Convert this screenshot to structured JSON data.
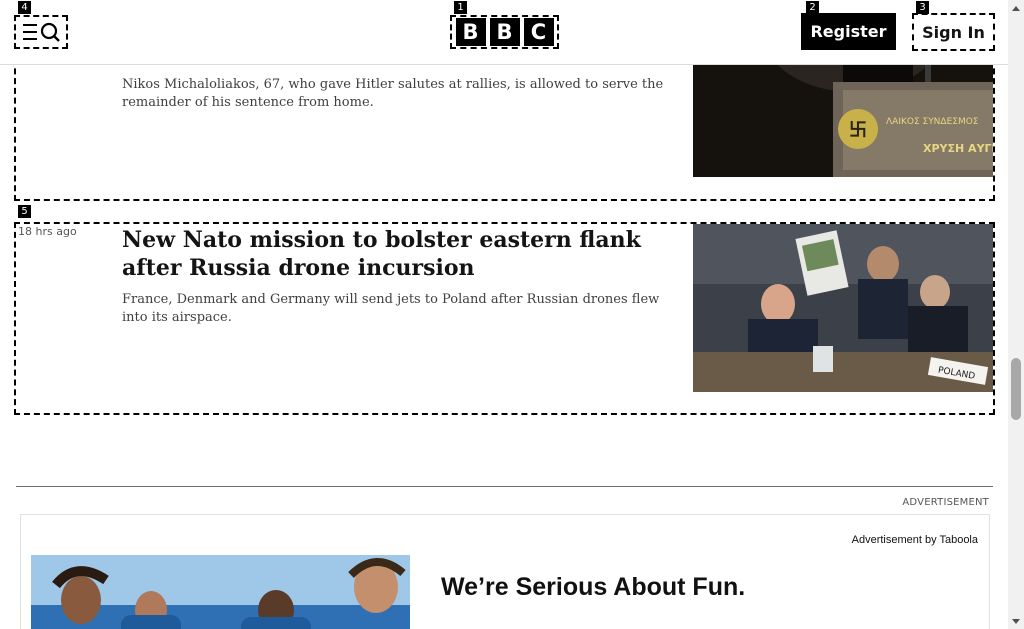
{
  "header": {
    "logo_letters": [
      "B",
      "B",
      "C"
    ],
    "register_label": "Register",
    "signin_label": "Sign In",
    "menu_icon": "menu-search-icon"
  },
  "markers": [
    "1",
    "2",
    "3",
    "4",
    "5"
  ],
  "articles": [
    {
      "summary": "Nikos Michaloliakos, 67, who gave Hitler salutes at rallies, is allowed to serve the remainder of his sentence from home.",
      "image_caption_text": "ΛΑΙΚΟΣ ΣΥΝΔΕΣΜΟΣ"
    },
    {
      "timestamp": "18 hrs ago",
      "headline": "New Nato mission to bolster eastern flank after Russia drone incursion",
      "summary": "France, Denmark and Germany will send jets to Poland after Russian drones flew into its airspace.",
      "image_caption_text": "POLAND"
    }
  ],
  "advert": {
    "label": "ADVERTISEMENT",
    "provider": "Advertisement by Taboola",
    "title": "We’re Serious About Fun."
  },
  "colors": {
    "brand": "#000000",
    "text": "#141414",
    "muted": "#545658"
  }
}
